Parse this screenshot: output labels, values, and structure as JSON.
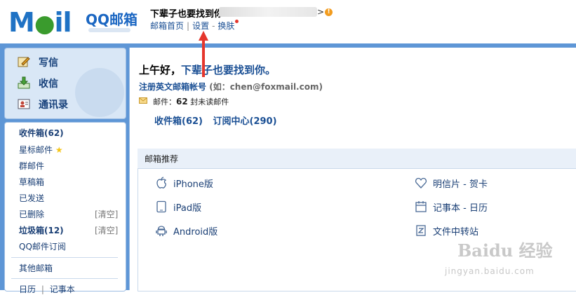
{
  "header": {
    "logo_text": "M",
    "logo_mid": "il",
    "product_name": "QQ邮箱",
    "user_name": "下辈子也要找到你",
    "user_arrow": ">",
    "links": {
      "home": "邮箱首页",
      "separator": "|",
      "settings": "设置",
      "dash": "-",
      "skin": "换肤"
    }
  },
  "quick_actions": [
    {
      "label": "写信",
      "icon": "compose-icon"
    },
    {
      "label": "收信",
      "icon": "inbox-download-icon"
    },
    {
      "label": "通讯录",
      "icon": "contacts-icon"
    }
  ],
  "folders": {
    "inbox": "收件箱(62)",
    "starred": "星标邮件",
    "group": "群邮件",
    "drafts": "草稿箱",
    "sent": "已发送",
    "deleted": "已删除",
    "deleted_clear": "[清空]",
    "spam": "垃圾箱(12)",
    "spam_clear": "[清空]",
    "subscriptions": "QQ邮件订阅",
    "other": "其他邮箱",
    "calendar": "日历",
    "calendar_sep": "|",
    "notes": "记事本"
  },
  "main": {
    "greeting_prefix": "上午好，",
    "greeting_name": "下辈子也要找到你。",
    "register_label": "注册英文邮箱帐号",
    "register_hint": "(如：chen@foxmail.com)",
    "mail_prefix": "邮件：",
    "unread_count": "62",
    "mail_suffix": "封未读邮件",
    "inbox_link": "收件箱(62)",
    "subscription_link": "订阅中心(290)"
  },
  "recommend": {
    "title": "邮箱推荐",
    "items": [
      {
        "label": "iPhone版",
        "icon": "apple-icon"
      },
      {
        "label": "iPad版",
        "icon": "ipad-icon"
      },
      {
        "label": "Android版",
        "icon": "android-icon"
      },
      {
        "label": "明信片 - 贺卡",
        "icon": "heart-icon"
      },
      {
        "label": "记事本 - 日历",
        "icon": "calendar-icon"
      },
      {
        "label": "文件中转站",
        "icon": "file-transfer-icon"
      }
    ]
  },
  "watermark": {
    "text": "Baidu 经验",
    "url": "jingyan.baidu.com"
  },
  "colors": {
    "frame_blue": "#5e96d6",
    "link_blue": "#1a4f94",
    "arrow_red": "#e5362c",
    "star_yellow": "#f5c518",
    "warning_orange": "#f29c1f"
  }
}
